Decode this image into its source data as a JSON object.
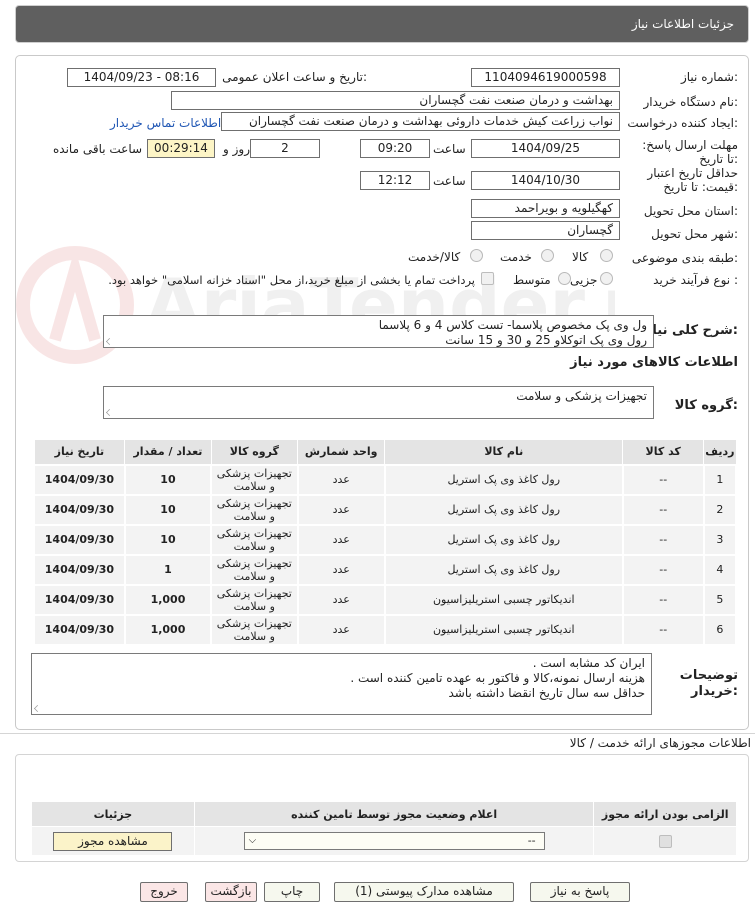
{
  "header": {
    "title": "جزئیات اطلاعات نیاز"
  },
  "form": {
    "need_number_label": "شماره نیاز:",
    "need_number": "1104094619000598",
    "announce_label": "تاریخ و ساعت اعلان عمومی:",
    "announce_value": "1404/09/23 - 08:16",
    "buyer_label": "نام دستگاه خریدار:",
    "buyer_value": "بهداشت و درمان صنعت نفت گچساران",
    "creator_label": "ایجاد کننده درخواست:",
    "creator_value": "نواب زراعت کیش خدمات داروئی بهداشت و درمان صنعت نفت گچساران",
    "contact_link": "اطلاعات تماس خریدار",
    "deadline_label": "مهلت ارسال پاسخ: تا تاریخ:",
    "deadline_date": "1404/09/25",
    "time_label": "ساعت",
    "deadline_time": "09:20",
    "days_value": "2",
    "days_label": "روز و",
    "remaining_value": "00:29:14",
    "remaining_label": "ساعت باقی مانده",
    "validity_label": "حداقل تاریخ اعتبار قیمت: تا تاریخ:",
    "validity_date": "1404/10/30",
    "validity_time": "12:12",
    "province_label": "استان محل تحویل:",
    "province_value": "کهگیلویه و بویراحمد",
    "city_label": "شهر محل تحویل:",
    "city_value": "گچساران",
    "category_label": "طبقه بندی موضوعی:",
    "category_options": [
      "کالا",
      "خدمت",
      "کالا/خدمت"
    ],
    "process_label": "نوع فرآیند خرید :",
    "process_options": [
      "جزیی",
      "متوسط"
    ],
    "payment_note": "پرداخت تمام یا بخشی از مبلغ خرید،از محل \"اسناد خزانه اسلامی\" خواهد بود."
  },
  "description": {
    "label": "شرح کلی نیاز:",
    "text_line1": "ول وی پک مخصوص پلاسما- تست کلاس 4 و 6 پلاسما",
    "text_line2": "رول وی پک اتوکلاو 25 و 30 و 15 سانت"
  },
  "goods_info_title": "اطلاعات کالاهای مورد نیاز",
  "goods_group": {
    "label": "گروه کالا:",
    "value": "تجهیزات پزشکی و سلامت"
  },
  "items_table": {
    "headers": [
      "ردیف",
      "کد کالا",
      "نام کالا",
      "واحد شمارش",
      "گروه کالا",
      "تعداد / مقدار",
      "تاریخ نیاز"
    ],
    "rows": [
      {
        "row": "1",
        "code": "--",
        "name": "رول کاغذ وی پک استریل",
        "unit": "عدد",
        "group_l1": "تجهیزات پزشکی",
        "group_l2": "و سلامت",
        "qty": "10",
        "date": "1404/09/30"
      },
      {
        "row": "2",
        "code": "--",
        "name": "رول کاغذ وی پک استریل",
        "unit": "عدد",
        "group_l1": "تجهیزات پزشکی",
        "group_l2": "و سلامت",
        "qty": "10",
        "date": "1404/09/30"
      },
      {
        "row": "3",
        "code": "--",
        "name": "رول کاغذ وی پک استریل",
        "unit": "عدد",
        "group_l1": "تجهیزات پزشکی",
        "group_l2": "و سلامت",
        "qty": "10",
        "date": "1404/09/30"
      },
      {
        "row": "4",
        "code": "--",
        "name": "رول کاغذ وی پک استریل",
        "unit": "عدد",
        "group_l1": "تجهیزات پزشکی",
        "group_l2": "و سلامت",
        "qty": "1",
        "date": "1404/09/30"
      },
      {
        "row": "5",
        "code": "--",
        "name": "اندیکاتور چسبی استریلیزاسیون",
        "unit": "عدد",
        "group_l1": "تجهیزات پزشکی",
        "group_l2": "و سلامت",
        "qty": "1,000",
        "date": "1404/09/30"
      },
      {
        "row": "6",
        "code": "--",
        "name": "اندیکاتور چسبی استریلیزاسیون",
        "unit": "عدد",
        "group_l1": "تجهیزات پزشکی",
        "group_l2": "و سلامت",
        "qty": "1,000",
        "date": "1404/09/30"
      }
    ]
  },
  "buyer_notes": {
    "label": "توضیحات خریدار:",
    "line1": "ایران کد مشابه است .",
    "line2": "هزینه ارسال نمونه،کالا و فاکتور به عهده تامین کننده است .",
    "line3": "حداقل سه سال تاریخ انقضا داشته باشد"
  },
  "license_section": {
    "title": "اطلاعات مجوزهای ارائه خدمت / کالا",
    "headers": [
      "الزامی بودن ارائه مجوز",
      "اعلام وضعیت مجوز توسط تامین کننده",
      "جزئیات"
    ],
    "select_value": "--",
    "view_button": "مشاهده مجوز"
  },
  "footer_buttons": {
    "reply": "پاسخ به نیاز",
    "attachments": "مشاهده مدارک پیوستی (1)",
    "print": "چاپ",
    "back": "بازگشت",
    "exit": "خروج"
  },
  "watermark_text": "AriaTender.neT",
  "colors": {
    "titlebar": "#5f5f5f",
    "link": "#1f56b4",
    "remaining_bg": "#fdf5c6",
    "pink_btn": "#fbe6e6"
  }
}
